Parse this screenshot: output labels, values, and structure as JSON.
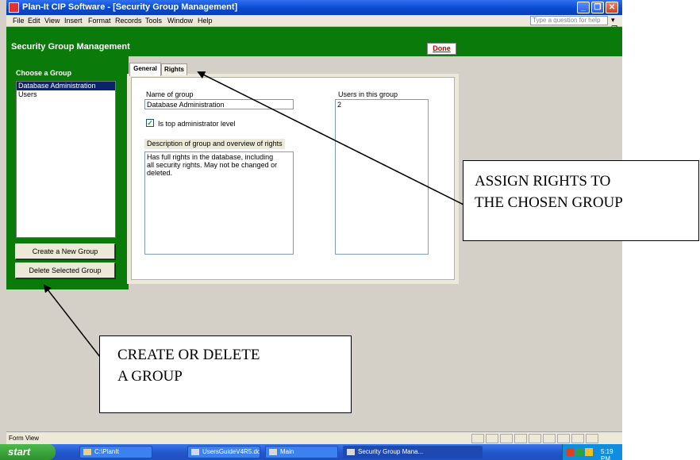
{
  "window": {
    "title": "Plan-It CIP Software - [Security Group Management]",
    "controls": [
      "minimize-icon",
      "restore-icon",
      "close-icon"
    ]
  },
  "menu": {
    "items": [
      "File",
      "Edit",
      "View",
      "Insert",
      "Format",
      "Records",
      "Tools",
      "Window",
      "Help"
    ],
    "help_placeholder": "Type a question for help"
  },
  "form": {
    "title": "Security Group Management",
    "done_label": "Done"
  },
  "groups_panel": {
    "label": "Choose a Group",
    "items": [
      "Database Administration",
      "Users"
    ],
    "selected_index": 0,
    "create_button": "Create a New Group",
    "delete_button": "Delete Selected Group"
  },
  "tabs": {
    "items": [
      "General",
      "Rights"
    ],
    "active": "General"
  },
  "general": {
    "name_label": "Name of group",
    "name_value": "Database Administration",
    "admin_checkbox_label": "Is top administrator level",
    "admin_checked": true,
    "description_label": "Description of group and overview of rights",
    "description_lines": [
      "Has full rights in the database, including",
      "all security rights.  May not be changed or",
      "deleted."
    ],
    "users_label": "Users in this group",
    "users_values": [
      "2"
    ]
  },
  "status": {
    "text": "Form View"
  },
  "taskbar": {
    "start_label": "start",
    "buttons": [
      "C:\\PlanIt",
      "UsersGuideV4R5.doc ...",
      "Main",
      "Security Group Mana..."
    ],
    "clock": "5:19 PM"
  },
  "annotations": {
    "rights_callout": [
      "ASSIGN RIGHTS TO",
      "THE CHOSEN GROUP"
    ],
    "group_callout": [
      "CREATE OR DELETE",
      "A GROUP"
    ]
  },
  "colors": {
    "form_green": "#0a7a0a",
    "titlebar_blue": "#0a4ad0",
    "selection": "#0a246a",
    "done_red": "#cc0000"
  }
}
